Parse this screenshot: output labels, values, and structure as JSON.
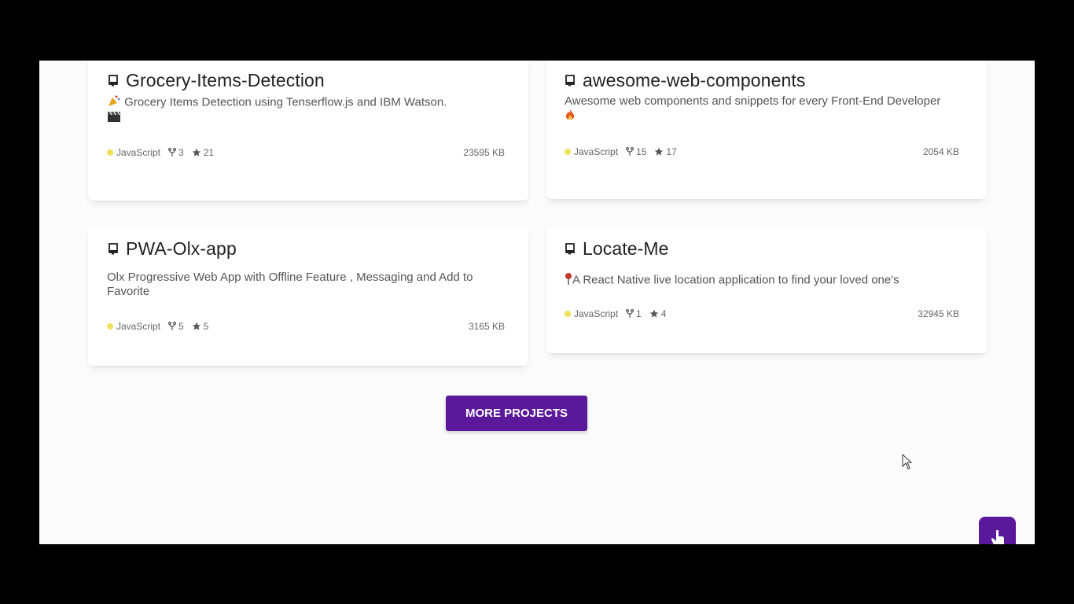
{
  "projects": [
    {
      "title": "Grocery-Items-Detection",
      "description": "Grocery Items Detection using Tenserflow.js and IBM Watson.",
      "language": "JavaScript",
      "forks": "3",
      "stars": "21",
      "size": "23595 KB",
      "lead_icon": "party-popper-icon",
      "trail_icon": "clapper-board-icon"
    },
    {
      "title": "awesome-web-components",
      "description": "Awesome web components and snippets for every Front-End Developer",
      "language": "JavaScript",
      "forks": "15",
      "stars": "17",
      "size": "2054 KB",
      "trail_icon": "fire-icon"
    },
    {
      "title": "PWA-Olx-app",
      "description": "Olx Progressive Web App with Offline Feature , Messaging and Add to Favorite",
      "language": "JavaScript",
      "forks": "5",
      "stars": "5",
      "size": "3165 KB"
    },
    {
      "title": "Locate-Me",
      "description": "A React Native live location application to find your loved one's",
      "language": "JavaScript",
      "forks": "1",
      "stars": "4",
      "size": "32945 KB",
      "lead_icon": "pushpin-icon"
    }
  ],
  "more_projects_label": "MORE PROJECTS",
  "colors": {
    "accent": "#5a189a",
    "language_dot": "#f1e05a",
    "background": "#fbfbfc"
  },
  "icons": {
    "repo": "repo-icon",
    "fork": "fork-icon",
    "star": "star-icon",
    "fab": "pointing-hand-icon",
    "cursor": "mouse-pointer-icon"
  }
}
